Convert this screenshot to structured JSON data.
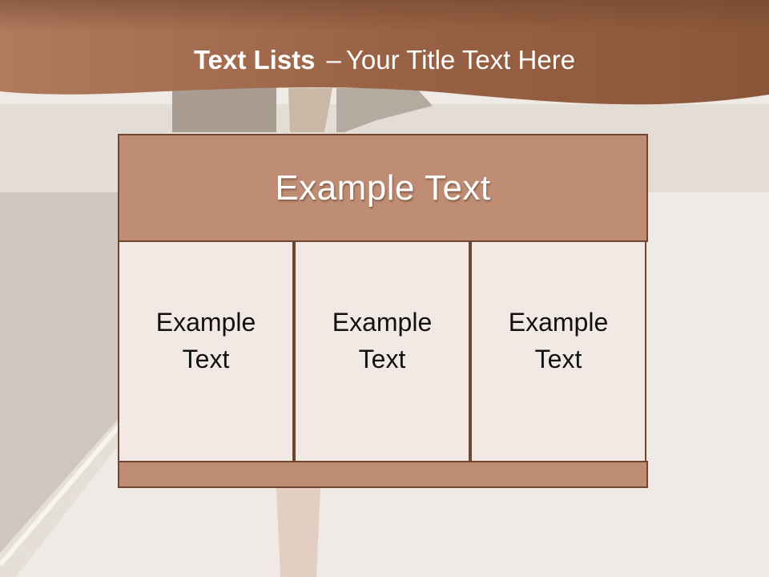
{
  "slide": {
    "title_bold": "Text Lists",
    "title_separator": "–",
    "title_rest": "Your Title Text Here",
    "header_text": "Example Text",
    "columns": [
      {
        "line1": "Example",
        "line2": "Text"
      },
      {
        "line1": "Example",
        "line2": "Text"
      },
      {
        "line1": "Example",
        "line2": "Text"
      }
    ]
  },
  "colors": {
    "banner": "#a0674a",
    "header_fill": "#bf8d74",
    "cell_fill": "#f3e9e4",
    "border": "#6e4530"
  }
}
